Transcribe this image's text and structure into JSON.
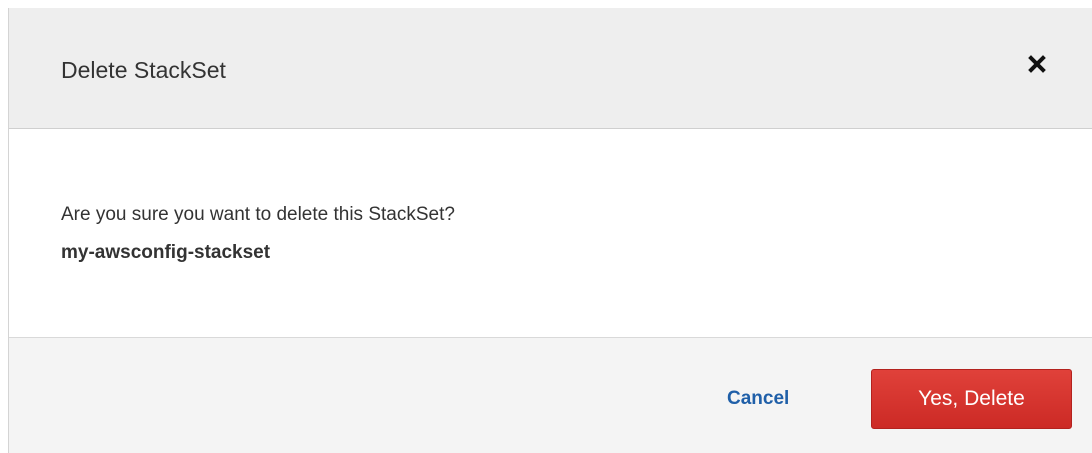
{
  "dialog": {
    "title": "Delete StackSet",
    "close_icon": "close-icon"
  },
  "body": {
    "question": "Are you sure you want to delete this StackSet?",
    "stackset_name": "my-awsconfig-stackset"
  },
  "footer": {
    "cancel_label": "Cancel",
    "confirm_label": "Yes, Delete"
  },
  "colors": {
    "header_bg": "#eeeeee",
    "footer_bg": "#f4f4f4",
    "link_blue": "#1f5fa8",
    "danger_red": "#d9302b",
    "text": "#333333"
  }
}
